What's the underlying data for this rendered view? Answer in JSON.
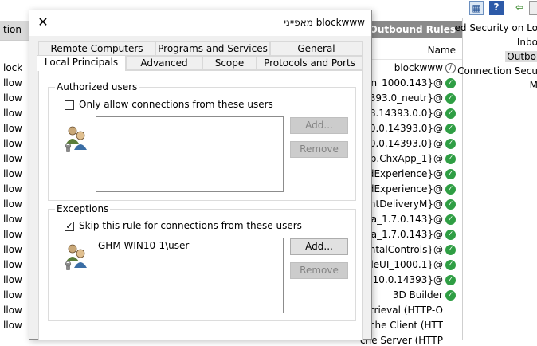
{
  "background": {
    "left_header": "tion",
    "left_rows": [
      "lock",
      "llow",
      "llow",
      "llow",
      "llow",
      "llow",
      "llow",
      "llow",
      "llow",
      "llow",
      "llow",
      "llow",
      "llow",
      "llow",
      "llow",
      "llow",
      "llow",
      "llow"
    ],
    "center_title": "Outbound Rules",
    "name_header": "Name",
    "name_rows": [
      {
        "text": "blockwww",
        "status": "block"
      },
      {
        "text": "ugin_1000.143}@",
        "status": "allow"
      },
      {
        "text": "14393.0_neutr}@",
        "status": "allow"
      },
      {
        "text": "e_38.14393.0.0}@",
        "status": "allow"
      },
      {
        "text": "n_10.0.14393.0}@",
        "status": "allow"
      },
      {
        "text": "n_10.0.14393.0}@",
        "status": "allow"
      },
      {
        "text": "rep.ChxApp_1}@",
        "status": "allow"
      },
      {
        "text": "oudExperience}@",
        "status": "allow"
      },
      {
        "text": "oudExperience}@",
        "status": "allow"
      },
      {
        "text": "ntentDeliveryM}@",
        "status": "allow"
      },
      {
        "text": "tana_1.7.0.143}@",
        "status": "allow"
      },
      {
        "text": "tana_1.7.0.143}@",
        "status": "allow"
      },
      {
        "text": "entalControls}@",
        "status": "allow"
      },
      {
        "text": "ableUI_1000.1}@",
        "status": "allow"
      },
      {
        "text": "ort_10.0.14393}@",
        "status": "allow"
      },
      {
        "text": "3D Builder",
        "status": "allow"
      },
      {
        "text": "etrieval (HTTP-O",
        "status": ""
      },
      {
        "text": "ache Client (HTT",
        "status": ""
      },
      {
        "text": "che Server (HTTP",
        "status": ""
      }
    ],
    "right_items": [
      "ed Security on Lo",
      "Inbo",
      "Outbo",
      "Connection Secu",
      "M"
    ]
  },
  "dialog": {
    "title": "מאפייני blockwww",
    "tabs_row1": [
      "Remote Computers",
      "Programs and Services",
      "General"
    ],
    "tabs_row2": [
      "Local Principals",
      "Advanced",
      "Scope",
      "Protocols and Ports"
    ],
    "authorized": {
      "group_title": "Authorized users",
      "checkbox_label": "Only allow connections from these users",
      "add": "Add...",
      "remove": "Remove"
    },
    "exceptions": {
      "group_title": "Exceptions",
      "checkbox_label": "Skip this rule for connections from these users",
      "items": [
        "GHM-WIN10-1\\user"
      ],
      "add": "Add...",
      "remove": "Remove"
    }
  }
}
